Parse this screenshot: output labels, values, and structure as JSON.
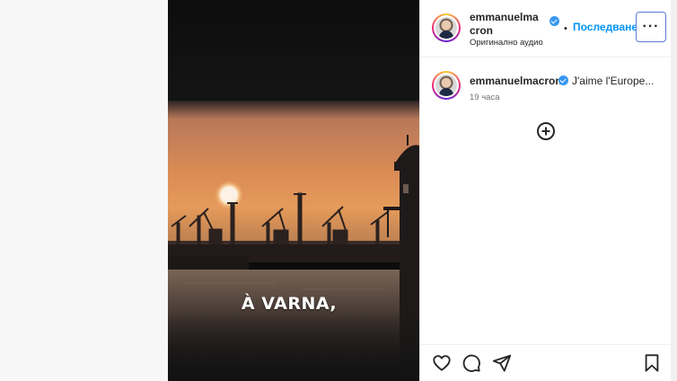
{
  "post": {
    "caption_overlay": "À VARNA,"
  },
  "header": {
    "username": "emmanuelmacron",
    "audio_label": "Оригинално аудио",
    "separator": "•",
    "follow_label": "Последване",
    "more_label": "···"
  },
  "comment": {
    "username": "emmanuelmacron",
    "text": "J'aime l'Europe...",
    "time": "19 часа"
  },
  "icons": {
    "verified": "verified-badge-icon",
    "add": "add-circle-icon",
    "like": "heart-icon",
    "comment": "comment-bubble-icon",
    "share": "paper-plane-icon",
    "save": "bookmark-icon"
  },
  "colors": {
    "accent": "#0095f6",
    "verified": "#3897f0",
    "sky_top": "#c9835a",
    "sky_horizon": "#e89a55"
  }
}
